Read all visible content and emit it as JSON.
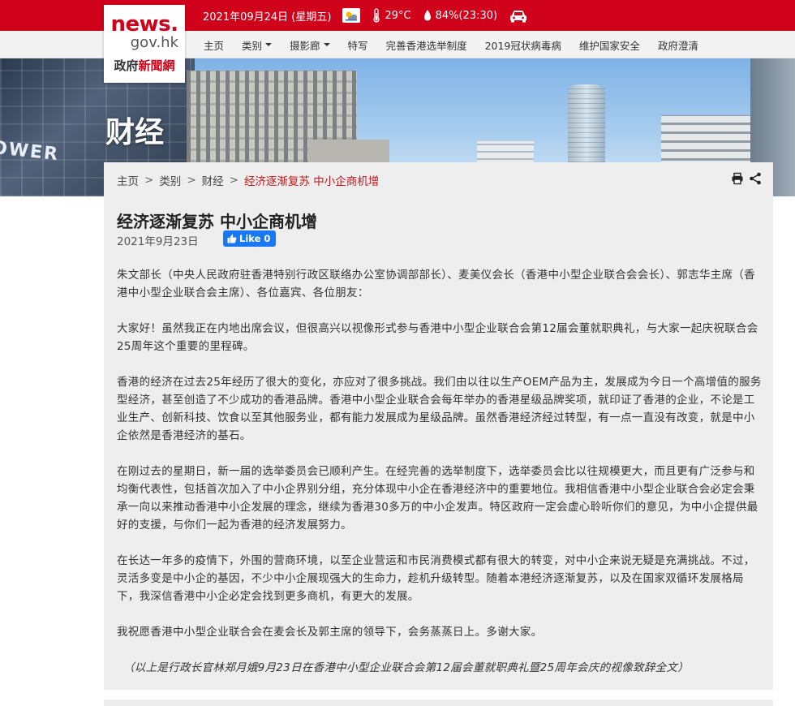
{
  "header": {
    "date": "2021年09月24日 (星期五)",
    "temperature": "29°C",
    "humidity": "84%(23:30)",
    "icons": [
      "weather-partly-cloudy-icon",
      "thermometer-icon",
      "humidity-drop-icon",
      "car-traffic-icon"
    ]
  },
  "logo": {
    "line1": "news.",
    "line2": "gov.hk",
    "line3_a": "政府",
    "line3_b": "新聞網"
  },
  "nav": {
    "items": [
      {
        "label": "主页"
      },
      {
        "label": "类别"
      },
      {
        "label": "摄影廊"
      },
      {
        "label": "特写"
      },
      {
        "label": "完善香港选举制度"
      },
      {
        "label": "2019冠状病毒病"
      },
      {
        "label": "维护国家安全"
      },
      {
        "label": "政府澄清"
      }
    ]
  },
  "banner": {
    "category_title": "财经",
    "sign_text": "OWER"
  },
  "breadcrumb": {
    "items": [
      "主页",
      "类别",
      "财经"
    ],
    "current": "经济逐渐复苏 中小企商机增"
  },
  "article": {
    "title": "经济逐渐复苏 中小企商机增",
    "date": "2021年9月23日",
    "like_label": "Like 0",
    "paragraphs": [
      "朱文部长（中央人民政府驻香港特别行政区联络办公室协调部部长）、麦美仪会长（香港中小型企业联合会会长）、郭志华主席（香港中小型企业联合会主席）、各位嘉宾、各位朋友：",
      "大家好！虽然我正在内地出席会议，但很高兴以视像形式参与香港中小型企业联合会第12届会董就职典礼，与大家一起庆祝联合会25周年这个重要的里程碑。",
      "香港的经济在过去25年经历了很大的变化，亦应对了很多挑战。我们由以往以生产OEM产品为主，发展成为今日一个高增值的服务型经济，甚至创造了不少成功的香港品牌。香港中小型企业联合会每年举办的香港星级品牌奖项，就印证了香港的企业，不论是工业生产、创新科技、饮食以至其他服务业，都有能力发展成为星级品牌。虽然香港经济经过转型，有一点一直没有改变，就是中小企依然是香港经济的基石。",
      "在刚过去的星期日，新一届的选举委员会已顺利产生。在经完善的选举制度下，选举委员会比以往规模更大，而且更有广泛参与和均衡代表性，包括首次加入了中小企界别分组，充分体现中小企在香港经济中的重要地位。我相信香港中小型企业联合会必定会秉承一向以来推动香港中小企发展的理念，继续为香港30多万的中小企发声。特区政府一定会虚心聆听你们的意见，为中小企提供最好的支援，与你们一起为香港的经济发展努力。",
      "在长达一年多的疫情下，外围的营商环境，以至企业营运和市民消费模式都有很大的转变，对中小企来说无疑是充满挑战。不过，灵活多变是中小企的基因，不少中小企展现强大的生命力，趁机升级转型。随着本港经济逐渐复苏，以及在国家双循环发展格局下，我深信香港中小企必定会找到更多商机，有更大的发展。",
      "我祝愿香港中小型企业联合会在麦会长及郭主席的领导下，会务蒸蒸日上。多谢大家。"
    ],
    "note": "（以上是行政长官林郑月娥9月23日在香港中小型企业联合会第12届会董就职典礼暨25周年会庆的视像致辞全文）"
  },
  "colors": {
    "brand_red": "#d0021b",
    "breadcrumb_current": "#c4161c",
    "facebook_blue": "#1877f2"
  }
}
